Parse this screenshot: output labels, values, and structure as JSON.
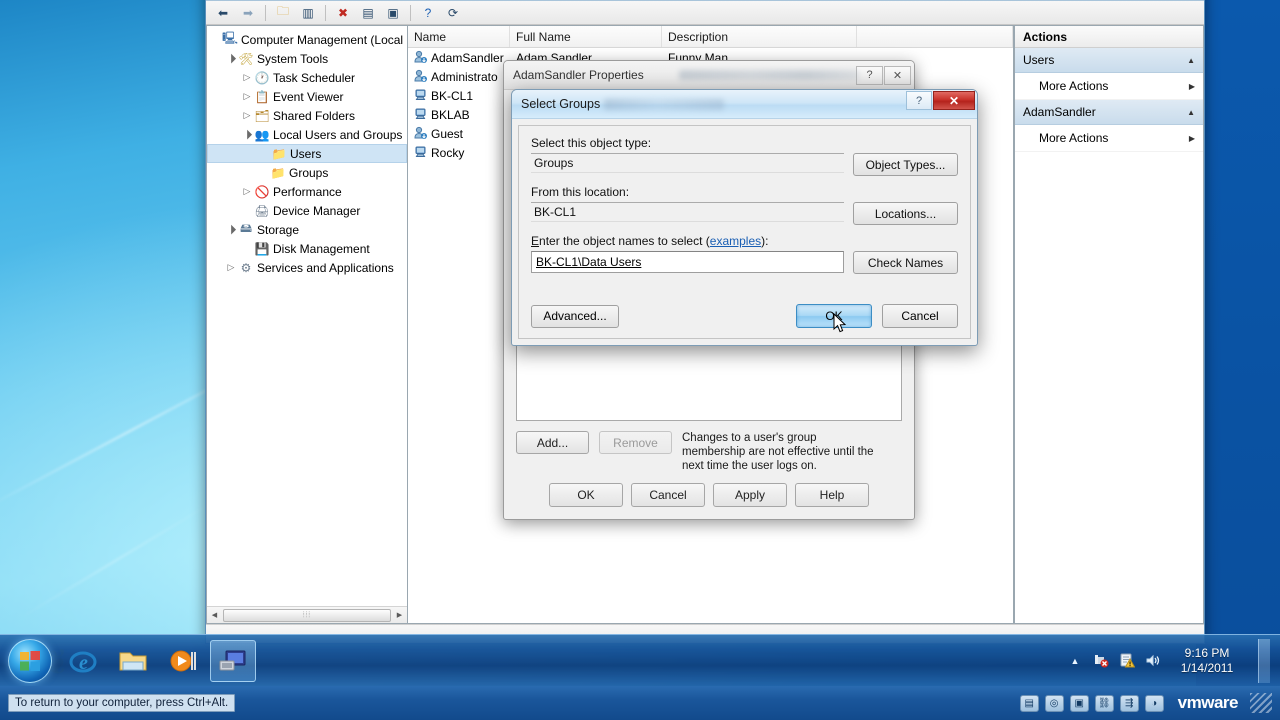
{
  "desktop": {
    "wallpaper_name": "windows7-blue-gradient"
  },
  "mmc": {
    "toolbar_icons": [
      "back-icon",
      "forward-icon",
      "up-folder-icon",
      "show-hide-tree-icon",
      "delete-icon",
      "properties-icon",
      "export-list-icon",
      "help-icon",
      "refresh-icon"
    ],
    "tree": [
      {
        "label": "Computer Management (Local",
        "icon": "computer-icon",
        "twisty": "",
        "indent": 0,
        "selected": false
      },
      {
        "label": "System Tools",
        "icon": "tools-icon",
        "twisty": "▲",
        "indent": 1,
        "selected": false
      },
      {
        "label": "Task Scheduler",
        "icon": "clock-icon",
        "twisty": "▷",
        "indent": 2,
        "selected": false
      },
      {
        "label": "Event Viewer",
        "icon": "event-log-icon",
        "twisty": "▷",
        "indent": 2,
        "selected": false
      },
      {
        "label": "Shared Folders",
        "icon": "shared-folder-icon",
        "twisty": "▷",
        "indent": 2,
        "selected": false
      },
      {
        "label": "Local Users and Groups",
        "icon": "users-group-icon",
        "twisty": "▲",
        "indent": 2,
        "selected": false
      },
      {
        "label": "Users",
        "icon": "folder-icon",
        "twisty": "",
        "indent": 3,
        "selected": true
      },
      {
        "label": "Groups",
        "icon": "folder-icon",
        "twisty": "",
        "indent": 3,
        "selected": false
      },
      {
        "label": "Performance",
        "icon": "performance-icon",
        "twisty": "▷",
        "indent": 2,
        "selected": false
      },
      {
        "label": "Device Manager",
        "icon": "device-manager-icon",
        "twisty": "",
        "indent": 2,
        "selected": false
      },
      {
        "label": "Storage",
        "icon": "storage-icon",
        "twisty": "▲",
        "indent": 1,
        "selected": false
      },
      {
        "label": "Disk Management",
        "icon": "disk-icon",
        "twisty": "",
        "indent": 2,
        "selected": false
      },
      {
        "label": "Services and Applications",
        "icon": "services-icon",
        "twisty": "▷",
        "indent": 1,
        "selected": false
      }
    ],
    "list": {
      "columns": [
        "Name",
        "Full Name",
        "Description"
      ],
      "rows": [
        {
          "icon": "user-account-icon",
          "name": "AdamSandler",
          "full_name": "Adam Sandler",
          "description": "Funny Man"
        },
        {
          "icon": "user-account-icon",
          "name": "Administrato",
          "full_name": "",
          "description": ""
        },
        {
          "icon": "user-computer-icon",
          "name": "BK-CL1",
          "full_name": "",
          "description": ""
        },
        {
          "icon": "user-computer-icon",
          "name": "BKLAB",
          "full_name": "",
          "description": ""
        },
        {
          "icon": "user-account-icon",
          "name": "Guest",
          "full_name": "",
          "description": ""
        },
        {
          "icon": "user-computer-icon",
          "name": "Rocky",
          "full_name": "",
          "description": ""
        }
      ]
    },
    "actions": {
      "title": "Actions",
      "groups": [
        {
          "header": "Users",
          "items": [
            "More Actions"
          ]
        },
        {
          "header": "AdamSandler",
          "items": [
            "More Actions"
          ]
        }
      ]
    }
  },
  "properties_dialog": {
    "title": "AdamSandler Properties",
    "help_label": "?",
    "close_label": "✕",
    "member_note": "Changes to a user's group membership are not effective until the next time the user logs on.",
    "add_label": "Add...",
    "remove_label": "Remove",
    "footer": [
      "OK",
      "Cancel",
      "Apply",
      "Help"
    ]
  },
  "select_groups": {
    "title": "Select Groups",
    "help_label": "?",
    "close_label": "✕",
    "object_type_label": "Select this object type:",
    "object_type_value": "Groups",
    "object_types_button": "Object Types...",
    "location_label": "From this location:",
    "location_value": "BK-CL1",
    "locations_button": "Locations...",
    "names_label_prefix": "E",
    "names_label_rest": "nter the object names to select (",
    "names_label_link": "examples",
    "names_label_suffix": "):",
    "names_value": "BK-CL1\\Data Users",
    "check_names_button": "Check Names",
    "advanced_button": "Advanced...",
    "ok_button": "OK",
    "cancel_button": "Cancel"
  },
  "taskbar": {
    "start_label": "start-orb",
    "items": [
      {
        "name": "internet-explorer",
        "icon": "e"
      },
      {
        "name": "windows-explorer",
        "icon": "folder"
      },
      {
        "name": "windows-media-player",
        "icon": "play"
      },
      {
        "name": "computer-management",
        "icon": "mmc"
      }
    ],
    "tray_icons": [
      "show-hidden-icons-chevron",
      "network-error-icon",
      "action-center-warning-icon",
      "volume-icon"
    ],
    "clock_time": "9:16 PM",
    "clock_date": "1/14/2011"
  },
  "vmware_bar": {
    "hint": "To return to your computer, press Ctrl+Alt.",
    "icons": [
      "hard-disk-icon",
      "cd-drive-icon",
      "floppy-icon",
      "network-icon",
      "usb-icon",
      "sound-icon"
    ],
    "logo": "vmware"
  }
}
